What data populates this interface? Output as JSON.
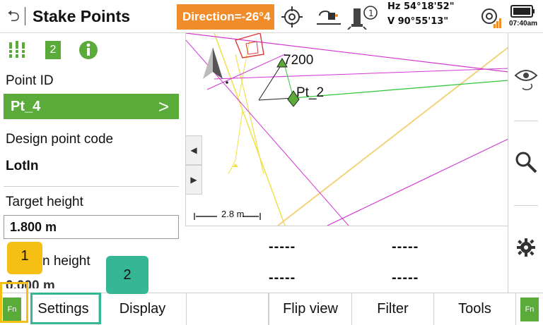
{
  "header": {
    "title": "Stake Points",
    "direction": "Direction=-26°4",
    "hz": "Hz 54°18'52\"",
    "v": "V   90°55'13\"",
    "time": "07:40am"
  },
  "left_panel": {
    "tab_icons": [
      "staking-icon",
      "page-2-icon",
      "info-icon"
    ],
    "page_number": "2",
    "point_id_label": "Point ID",
    "point_id_value": "Pt_4",
    "design_code_label": "Design point code",
    "design_code_value": "LotIn",
    "target_height_label": "Target height",
    "target_height_value": "1.800 m",
    "antenna_height_label": "n height",
    "antenna_height_value": "0.000 m"
  },
  "map": {
    "label_7200": "7200",
    "label_pt2": "Pt_2",
    "scale": "2.8 m"
  },
  "readout": {
    "row1_col1": "-----",
    "row1_col2": "-----",
    "row2_col1": "-----",
    "row2_col2": "-----"
  },
  "softkeys": {
    "fn_left": "Fn",
    "settings": "Settings",
    "display": "Display",
    "flip_view": "Flip view",
    "filter": "Filter",
    "tools": "Tools",
    "fn_right": "Fn"
  },
  "annotations": {
    "badge1": "1",
    "badge2": "2"
  },
  "colors": {
    "accent_green": "#5aab3a",
    "direction_orange": "#f08c2a",
    "badge_yellow": "#f5bf13",
    "badge_teal": "#35b795"
  }
}
